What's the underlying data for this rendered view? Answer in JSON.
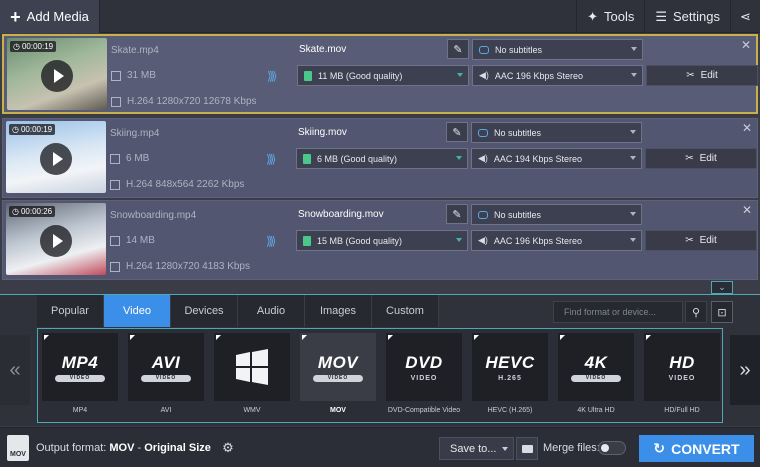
{
  "toolbar": {
    "add_media": "Add Media",
    "tools": "Tools",
    "settings": "Settings"
  },
  "files": [
    {
      "duration": "00:00:19",
      "src_name": "Skate.mp4",
      "src_size": "31 MB",
      "src_codec": "H.264 1280x720 12678 Kbps",
      "out_name": "Skate.mov",
      "out_size": "11 MB (Good quality)",
      "subtitles": "No subtitles",
      "audio": "AAC 196 Kbps Stereo",
      "edit": "Edit"
    },
    {
      "duration": "00:00:19",
      "src_name": "Skiing.mp4",
      "src_size": "6 MB",
      "src_codec": "H.264 848x564 2262 Kbps",
      "out_name": "Skiing.mov",
      "out_size": "6 MB (Good quality)",
      "subtitles": "No subtitles",
      "audio": "AAC 194 Kbps Stereo",
      "edit": "Edit"
    },
    {
      "duration": "00:00:26",
      "src_name": "Snowboarding.mp4",
      "src_size": "14 MB",
      "src_codec": "H.264 1280x720 4183 Kbps",
      "out_name": "Snowboarding.mov",
      "out_size": "15 MB (Good quality)",
      "subtitles": "No subtitles",
      "audio": "AAC 196 Kbps Stereo",
      "edit": "Edit"
    }
  ],
  "format_tabs": [
    "Popular",
    "Video",
    "Devices",
    "Audio",
    "Images",
    "Custom"
  ],
  "active_tab": "Video",
  "search_placeholder": "Find format or device...",
  "presets": [
    {
      "big": "MP4",
      "sub": "VIDEO",
      "caption": "MP4"
    },
    {
      "big": "AVI",
      "sub": "VIDEO",
      "caption": "AVI"
    },
    {
      "big": "",
      "sub": "",
      "caption": "WMV",
      "icon": "windows-logo-icon"
    },
    {
      "big": "MOV",
      "sub": "VIDEO",
      "caption": "MOV"
    },
    {
      "big": "DVD",
      "sub": "VIDEO",
      "caption": "DVD-Compatible Video"
    },
    {
      "big": "HEVC",
      "sub": "H.265",
      "caption": "HEVC (H.265)"
    },
    {
      "big": "4K",
      "sub": "VIDEO",
      "caption": "4K Ultra HD"
    },
    {
      "big": "HD",
      "sub": "VIDEO",
      "caption": "HD/Full HD"
    }
  ],
  "selected_preset": "MOV",
  "bottom": {
    "file_icon_label": "MOV",
    "output_label": "Output format:",
    "output_format": "MOV",
    "dash": "-",
    "output_size": "Original Size",
    "save_to": "Save to...",
    "merge_files": "Merge files:",
    "convert": "CONVERT"
  },
  "colors": {
    "accent": "#3c8fe8",
    "selection_border": "#c9b14a",
    "panel_outline": "#4fa9b3"
  }
}
